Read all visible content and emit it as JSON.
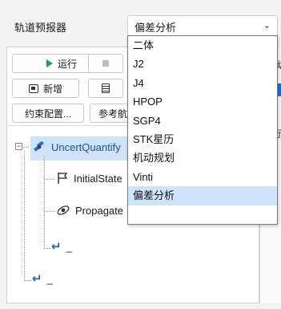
{
  "propagator": {
    "label": "轨道预报器",
    "selected": "偏差分析",
    "options": [
      "二体",
      "J2",
      "J4",
      "HPOP",
      "SGP4",
      "STK星历",
      "机动规划",
      "Vinti",
      "偏差分析"
    ]
  },
  "toolbar": {
    "run_label": "运行",
    "new_label": "新增",
    "constraint_label": "约束配置...",
    "reference_label": "参考航"
  },
  "tree": {
    "root_label": "UncertQuantify",
    "initial_state_label": "InitialState",
    "propagate_label": "Propagate",
    "return_label_1": "_",
    "return_label_2": "_"
  },
  "right_panel": {
    "text_1": "坳",
    "text_2": "示"
  },
  "colors": {
    "accent": "#1e6fd9",
    "selection": "#cfe3fa",
    "run_green": "#19a34a"
  }
}
